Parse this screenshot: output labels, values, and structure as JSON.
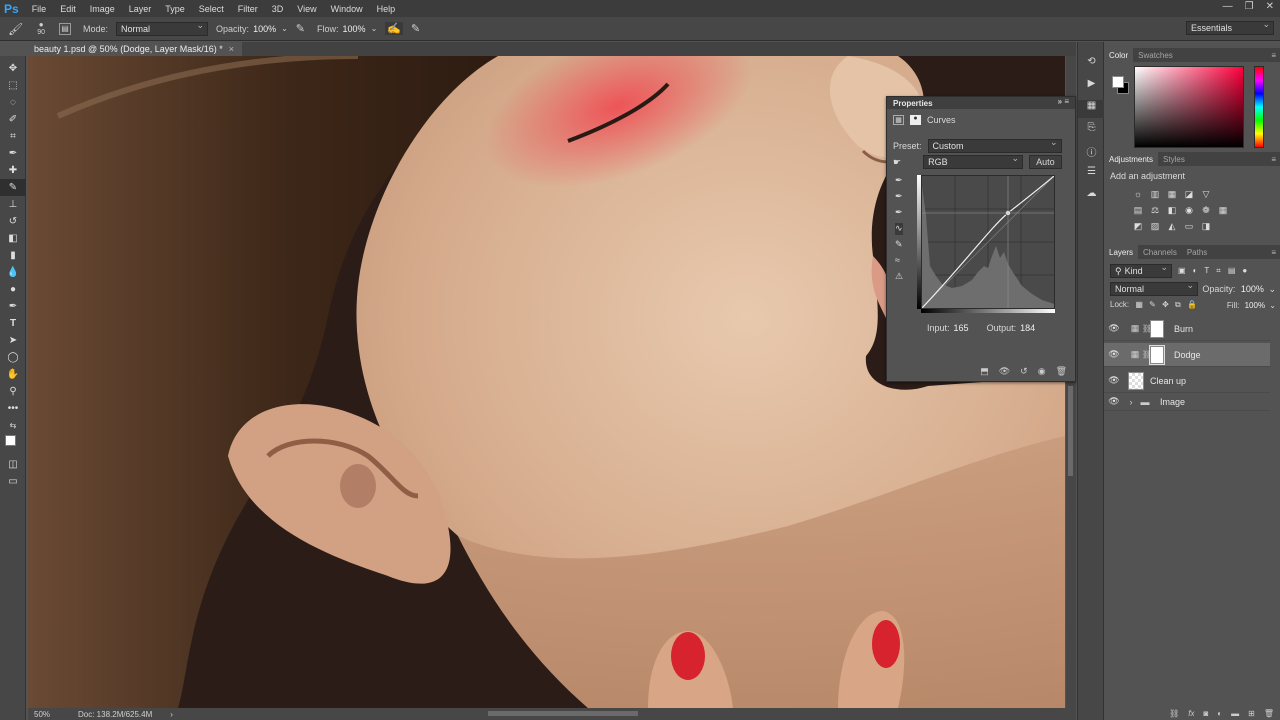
{
  "app": {
    "logo": "Ps"
  },
  "menu": [
    "File",
    "Edit",
    "Image",
    "Layer",
    "Type",
    "Select",
    "Filter",
    "3D",
    "View",
    "Window",
    "Help"
  ],
  "window_controls": [
    "—",
    "❐",
    "✕"
  ],
  "options": {
    "brush_size": "90",
    "mode_label": "Mode:",
    "mode_value": "Normal",
    "opacity_label": "Opacity:",
    "opacity_value": "100%",
    "flow_label": "Flow:",
    "flow_value": "100%",
    "workspace": "Essentials"
  },
  "document": {
    "tab_title": "beauty 1.psd @ 50% (Dodge, Layer Mask/16) *",
    "tab_close": "×"
  },
  "status": {
    "zoom": "50%",
    "doc": "Doc: 138.2M/625.4M",
    "arrow": "›"
  },
  "properties": {
    "title": "Properties",
    "controls": "» ≡",
    "type": "Curves",
    "preset_label": "Preset:",
    "preset_value": "Custom",
    "channel_value": "RGB",
    "auto_label": "Auto",
    "input_label": "Input:",
    "input_value": "165",
    "output_label": "Output:",
    "output_value": "184",
    "curve_point": {
      "input": 165,
      "output": 184
    }
  },
  "color_panel": {
    "tabs": [
      "Color",
      "Swatches"
    ],
    "menu": "≡"
  },
  "adjustments_panel": {
    "tabs": [
      "Adjustments",
      "Styles"
    ],
    "menu": "≡",
    "title": "Add an adjustment"
  },
  "layers_panel": {
    "tabs": [
      "Layers",
      "Channels",
      "Paths"
    ],
    "menu": "≡",
    "kind_label": "Kind",
    "blend_mode": "Normal",
    "opacity_label": "Opacity:",
    "opacity_value": "100%",
    "lock_label": "Lock:",
    "fill_label": "Fill:",
    "fill_value": "100%",
    "layers": [
      {
        "name": "Burn",
        "kind": "adjustment"
      },
      {
        "name": "Dodge",
        "kind": "adjustment",
        "selected": true
      },
      {
        "name": "Clean up",
        "kind": "pixel"
      },
      {
        "name": "Image",
        "kind": "group"
      }
    ]
  },
  "colors": {
    "accent": "#31a8ff",
    "eyeshadow": "#ef4f55",
    "nail": "#d6232e"
  }
}
